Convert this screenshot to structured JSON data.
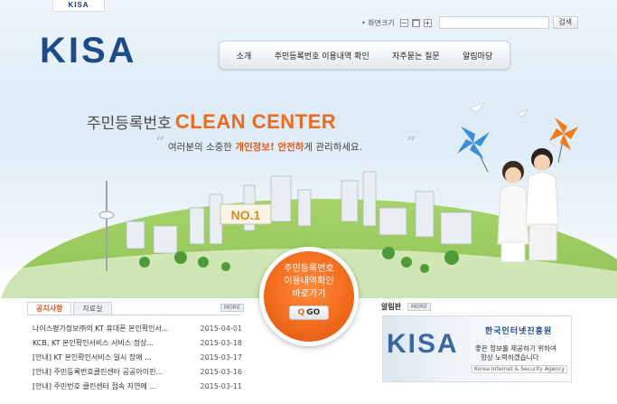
{
  "header": {
    "top_tab": "KISA",
    "logo": "KISA",
    "util": {
      "label": "• 화면크기",
      "minus": "−",
      "mid": "■",
      "plus": "+",
      "search_value": "",
      "search_button": "검색"
    }
  },
  "nav": {
    "items": [
      {
        "label": "소개"
      },
      {
        "label": "주민등록번호 이용내역 확인"
      },
      {
        "label": "자주묻는 질문"
      },
      {
        "label": "알림마당"
      }
    ]
  },
  "hero": {
    "title_ko": "주민등록번호",
    "title_en": "CLEAN CENTER",
    "sub_pre": "여러분의 소중한",
    "sub_hl1": "개인정보! 안전하",
    "sub_post": "게 관리하세요.",
    "billboard": "NO.1"
  },
  "cta": {
    "line1": "주민등록번호",
    "line2": "이용내역확인",
    "line3": "바로가기",
    "go": "GO"
  },
  "notice": {
    "tab_active": "공지사항",
    "tab_other": "자료실",
    "more": "MORE",
    "items": [
      {
        "title": "나이스평가정보㈜의 KT 휴대폰 본인확인서...",
        "date": "2015-04-01"
      },
      {
        "title": "KCB, KT 본인확인서비스 서비스 정상...",
        "date": "2015-03-18"
      },
      {
        "title": "[안내] KT 본인확인서비스 일시 장애 ...",
        "date": "2015-03-17"
      },
      {
        "title": "[안내] 주민등록번호클린센터 공공아이핀...",
        "date": "2015-03-16"
      },
      {
        "title": "[안내] 주민번호 클린센터 접속 지연에 ...",
        "date": "2015-03-11"
      }
    ]
  },
  "popup": {
    "title": "알림판",
    "more": "MORE",
    "logo": "KISA",
    "org": "한국인터넷진흥원",
    "t1": "좋은 정보를 제공하기 위하여",
    "t2": "항상 노력하겠습니다",
    "eng": "Korea Internet & Security Agency"
  },
  "colors": {
    "brand_blue": "#1f4a8a",
    "accent_orange": "#ee6a1e"
  }
}
